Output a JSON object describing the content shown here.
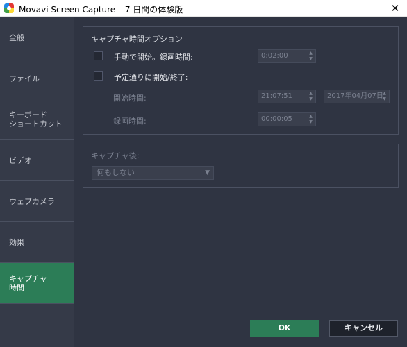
{
  "window": {
    "title": "Movavi Screen Capture – 7 日間の体験版",
    "close_glyph": "✕"
  },
  "sidebar": {
    "items": [
      {
        "label": "全般"
      },
      {
        "label": "ファイル"
      },
      {
        "label": "キーボード\nショートカット"
      },
      {
        "label": "ビデオ"
      },
      {
        "label": "ウェブカメラ"
      },
      {
        "label": "効果"
      },
      {
        "label": "キャプチャ\n時間"
      }
    ],
    "active_index": 6
  },
  "capture_options": {
    "title": "キャプチャ時間オプション",
    "manual_start": {
      "label": "手動で開始。録画時間:",
      "checked": false,
      "duration": "0:02:00"
    },
    "scheduled": {
      "label": "予定通りに開始/終了:",
      "checked": false,
      "start_label": "開始時間:",
      "start_time": "21:07:51",
      "start_date": "2017年04月07日",
      "duration_label": "録画時間:",
      "duration": "00:00:05"
    }
  },
  "after_capture": {
    "title": "キャプチャ後:",
    "selected": "何もしない"
  },
  "buttons": {
    "ok": "OK",
    "cancel": "キャンセル"
  },
  "icons": {
    "app": "movavi-app-icon",
    "spin_up": "▲",
    "spin_down": "▼",
    "dropdown_caret": "▼"
  },
  "colors": {
    "accent": "#2c7d57",
    "background": "#2f3442",
    "sidebar": "#353a48"
  }
}
